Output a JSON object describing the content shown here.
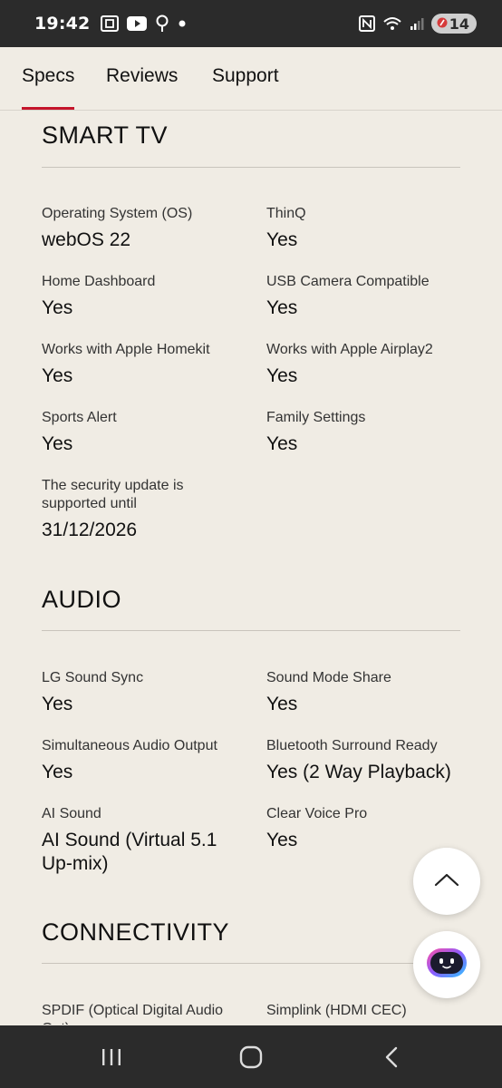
{
  "status_bar": {
    "time": "19:42",
    "left_icons": [
      "screenshot-icon",
      "youtube-icon",
      "location-pin-icon",
      "dot-icon"
    ],
    "right_icons": [
      "nfc-icon",
      "wifi-icon",
      "signal-icon"
    ],
    "battery": "14"
  },
  "tabs": [
    {
      "label": "Specs",
      "active": true
    },
    {
      "label": "Reviews",
      "active": false
    },
    {
      "label": "Support",
      "active": false
    }
  ],
  "sections": {
    "smart_tv": {
      "title": "SMART TV",
      "specs": [
        {
          "label": "Operating System (OS)",
          "value": "webOS 22"
        },
        {
          "label": "ThinQ",
          "value": "Yes"
        },
        {
          "label": "Home Dashboard",
          "value": "Yes"
        },
        {
          "label": "USB Camera Compatible",
          "value": "Yes"
        },
        {
          "label": "Works with Apple Homekit",
          "value": "Yes"
        },
        {
          "label": "Works with Apple Airplay2",
          "value": "Yes"
        },
        {
          "label": "Sports Alert",
          "value": "Yes"
        },
        {
          "label": "Family Settings",
          "value": "Yes"
        },
        {
          "label": "The security update is supported until",
          "value": "31/12/2026"
        }
      ]
    },
    "audio": {
      "title": "AUDIO",
      "specs": [
        {
          "label": "LG Sound Sync",
          "value": "Yes"
        },
        {
          "label": "Sound Mode Share",
          "value": "Yes"
        },
        {
          "label": "Simultaneous Audio Output",
          "value": "Yes"
        },
        {
          "label": "Bluetooth Surround Ready",
          "value": "Yes (2 Way Playback)"
        },
        {
          "label": "AI Sound",
          "value": "AI Sound (Virtual 5.1 Up-mix)"
        },
        {
          "label": "Clear Voice Pro",
          "value": "Yes"
        }
      ]
    },
    "connectivity": {
      "title": "CONNECTIVITY",
      "specs": [
        {
          "label": "SPDIF (Optical Digital Audio Out)",
          "value": ""
        },
        {
          "label": "Simplink (HDMI CEC)",
          "value": ""
        }
      ]
    }
  },
  "colors": {
    "accent": "#c5152b",
    "background": "#f0ece4",
    "status_bar": "#2b2b2b"
  },
  "floating": {
    "scroll_top_icon": "chevron-up-icon",
    "chatbot_icon": "chatbot-icon"
  },
  "nav_bar": {
    "icons": [
      "recent-apps-icon",
      "home-icon",
      "back-icon"
    ]
  }
}
